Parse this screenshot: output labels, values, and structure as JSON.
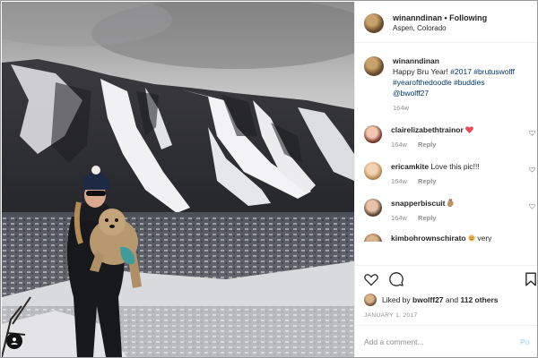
{
  "header": {
    "username": "winanndinan",
    "separator": " • ",
    "follow_status": "Following",
    "location": "Aspen, Colorado"
  },
  "caption": {
    "username": "winanndinan",
    "text": "Happy Bru Year!",
    "hashtags": [
      "#2017",
      "#brutuswolff",
      "#yearofthedoodle",
      "#buddies"
    ],
    "mention": "@bwolff27",
    "age": "164w"
  },
  "comments": [
    {
      "username": "clairelizabethtrainor",
      "text": "",
      "emoji": "red-heart",
      "age": "164w",
      "reply_label": "Reply"
    },
    {
      "username": "ericamkite",
      "text": "Love this pic!!!",
      "emoji": "",
      "age": "164w",
      "reply_label": "Reply"
    },
    {
      "username": "snapperbiscuit",
      "text": "",
      "emoji": "hand",
      "age": "164w",
      "reply_label": "Reply"
    },
    {
      "username": "kimbohrownschirato",
      "text": "very",
      "emoji": "face",
      "age": "",
      "reply_label": ""
    }
  ],
  "likes": {
    "prefix": "Liked by",
    "user": "bwolff27",
    "and": "and",
    "others": "112 others"
  },
  "post_date": "JANUARY 1, 2017",
  "add_comment": {
    "placeholder": "Add a comment...",
    "post_label": "Po"
  },
  "colors": {
    "link": "#00376b",
    "muted": "#8e8e8e",
    "heart": "#ed4956",
    "post_button": "#b2dffc"
  },
  "icons": [
    "heart-icon",
    "comment-icon",
    "bookmark-icon",
    "user-icon"
  ]
}
